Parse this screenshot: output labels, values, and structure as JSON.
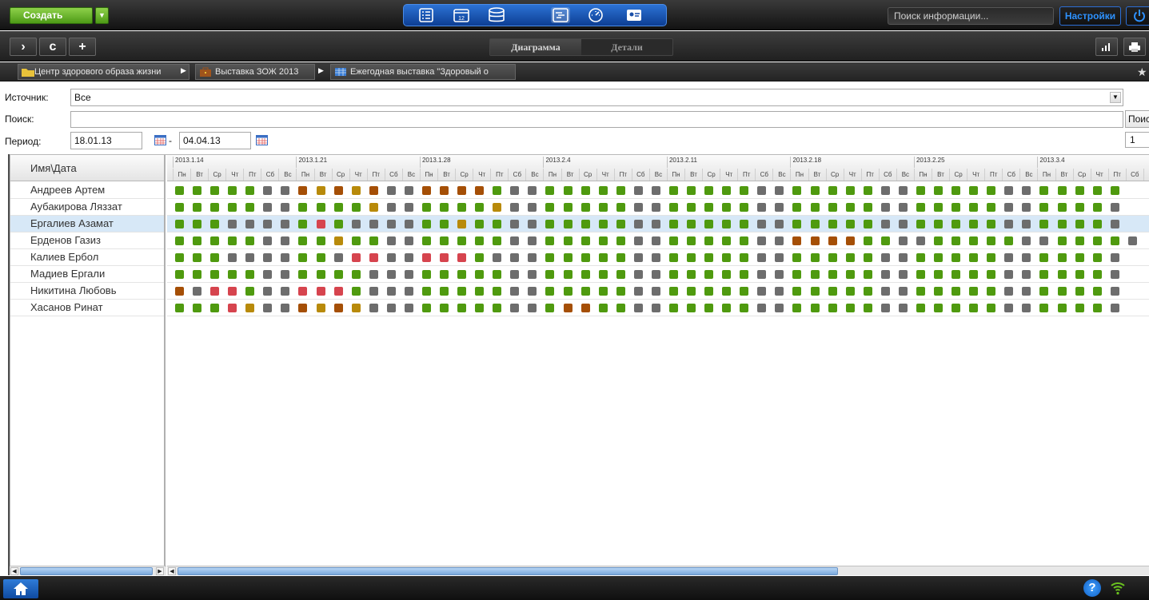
{
  "topbar": {
    "create_label": "Создать",
    "create_dropdown": "▼",
    "search_placeholder": "Поиск информации...",
    "settings_label": "Настройки",
    "modes": [
      "list-icon",
      "calendar-icon",
      "database-icon",
      "gantt-icon",
      "dashboard-icon",
      "contacts-icon"
    ],
    "calendar_day": "12"
  },
  "toolbar": {
    "forward": "›",
    "refresh": "c",
    "add": "+",
    "tabs": [
      {
        "label": "Диаграмма",
        "active": true
      },
      {
        "label": "Детали",
        "active": false
      }
    ]
  },
  "breadcrumbs": [
    {
      "label": "Центр здорового образа жизни",
      "icon": "folder-icon"
    },
    {
      "label": "Выставка ЗОЖ 2013",
      "icon": "briefcase-icon"
    },
    {
      "label": "Ежегодная выставка \"Здоровый о",
      "icon": "table-icon"
    }
  ],
  "filters": {
    "source_label": "Источник:",
    "source_value": "Все",
    "search_label": "Поиск:",
    "search_value": "",
    "search_button": "Поис",
    "period_label": "Период:",
    "date_from": "18.01.13",
    "date_sep": "-",
    "date_to": "04.04.13",
    "page_value": "1"
  },
  "grid": {
    "name_header": "Имя\\Дата",
    "weeks": [
      "2013.1.14",
      "2013.1.21",
      "2013.1.28",
      "2013.2.4",
      "2013.2.11",
      "2013.2.18",
      "2013.2.25",
      "2013.3.4"
    ],
    "days": [
      "Пн",
      "Вт",
      "Ср",
      "Чт",
      "Пт",
      "Сб",
      "Вс"
    ],
    "colors": {
      "g": "#4f9a0f",
      "x": "#6d6d6d",
      "o": "#a54f06",
      "y": "#b88a0a",
      "r": "#d6444e"
    },
    "selected_row": 2,
    "rows": [
      {
        "name": "Андреев Артем",
        "status": "gggggxxoyoyoxxoooogxxgggggxxgggggxxgggggxxgggggxxggggg"
      },
      {
        "name": "Аубакирова Ляззат",
        "status": "gggggxxggggyxxggggyxxgggggxxgggggxxgggggxxgggggxxggggx"
      },
      {
        "name": "Ергалиев Азамат",
        "status": "gggxxxxgrgxxxxggyggxxgggggxxgggggxxgggggxxgggggxxggggx"
      },
      {
        "name": "Ерденов Газиз",
        "status": "gggggxxggyggxxgggggxxgggggxxgggggxxooooggxxgggggxxggggx"
      },
      {
        "name": "Калиев Ербол",
        "status": "gggxxxxggxrrxxrrrgxxxgggggxxgggggxxgggggxxgggggxxggggx"
      },
      {
        "name": "Мадиев Ергали",
        "status": "gggggxxggggxxxgggggxxgggggxxgggggxxgggggxxgggggxxggggx"
      },
      {
        "name": "Никитина Любовь",
        "status": "oxrrgxxrrrgxxxgggggxxgggggxxgggggxxgggggxxgggggxxggggx"
      },
      {
        "name": "Хасанов Ринат",
        "status": "gggryxxoyoyxxxgggggxxgooggxxgggggxxgggggxxgggggxxggggx"
      }
    ]
  },
  "bottombar": {
    "help": "?"
  }
}
